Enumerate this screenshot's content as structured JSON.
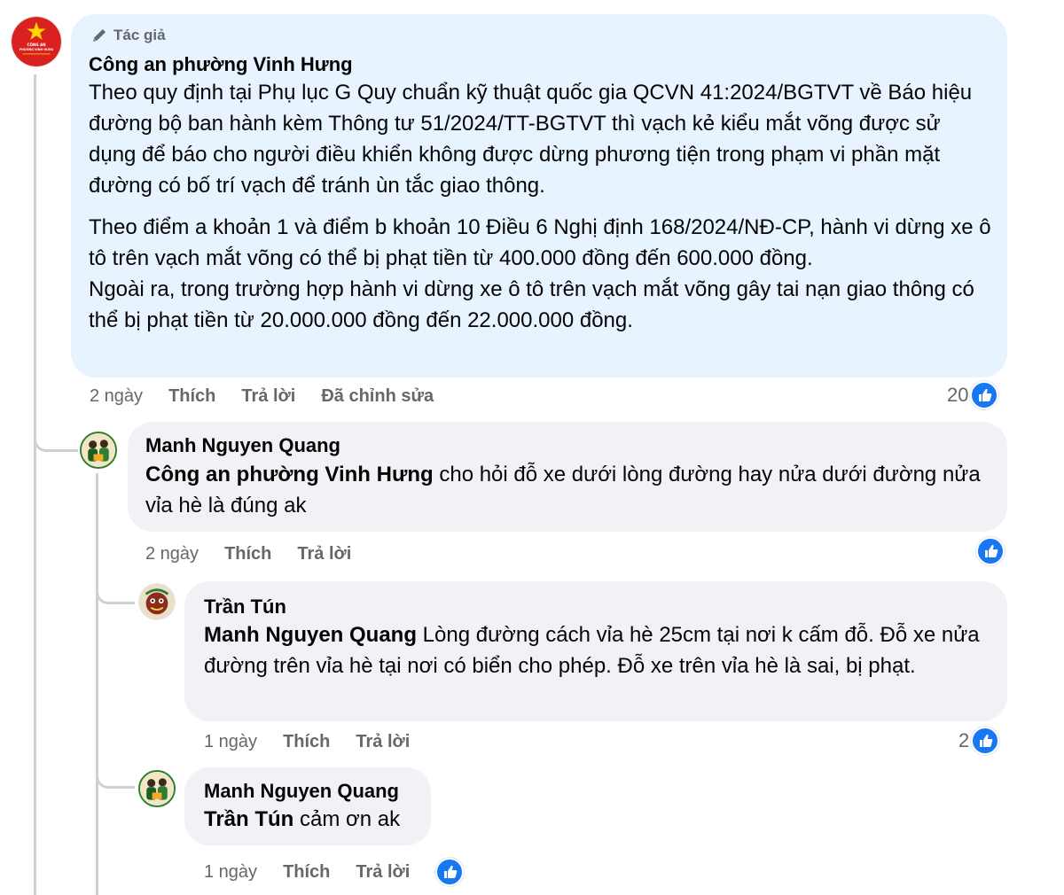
{
  "comments": [
    {
      "author_badge": "Tác giả",
      "author": "Công an phường Vinh Hưng",
      "paragraph1": "Theo quy định tại Phụ lục G Quy chuẩn kỹ thuật quốc gia QCVN 41:2024/BGTVT về Báo hiệu đường bộ ban hành kèm Thông tư 51/2024/TT-BGTVT thì vạch kẻ kiểu mắt võng được sử dụng để báo cho người điều khiển không được dừng phương tiện trong phạm vi phần mặt đường có bố trí vạch để tránh ùn tắc giao thông.",
      "paragraph2": "Theo điểm a khoản 1 và điểm b khoản 10 Điều 6 Nghị định 168/2024/NĐ-CP, hành vi dừng xe ô tô trên vạch mắt võng có thể bị phạt tiền từ 400.000 đồng đến 600.000 đồng.",
      "paragraph3": "Ngoài ra, trong trường hợp hành vi dừng xe ô tô trên vạch mắt võng gây tai nạn giao thông có thể bị phạt tiền từ 20.000.000 đồng đến 22.000.000 đồng.",
      "time": "2 ngày",
      "like_label": "Thích",
      "reply_label": "Trả lời",
      "edited_label": "Đã chỉnh sửa",
      "reaction_count": "20",
      "avatar_text": [
        "CÔNG AN",
        "PHƯỜNG VINH HƯNG"
      ]
    },
    {
      "author": "Manh Nguyen Quang",
      "mention": "Công an phường Vinh Hưng",
      "text": " cho hỏi đỗ xe dưới lòng đường hay nửa dưới đường nửa vỉa hè là đúng ak",
      "time": "2 ngày",
      "like_label": "Thích",
      "reply_label": "Trả lời",
      "reaction_count": ""
    },
    {
      "author": "Trần Tún",
      "mention": "Manh Nguyen Quang",
      "text": " Lòng đường cách vỉa hè 25cm tại nơi k cấm đỗ. Đỗ xe nửa đường trên vỉa hè tại nơi có biển cho phép. Đỗ xe trên vỉa hè là sai, bị phạt.",
      "time": "1 ngày",
      "like_label": "Thích",
      "reply_label": "Trả lời",
      "reaction_count": "2"
    },
    {
      "author": "Manh Nguyen Quang",
      "mention": "Trần Tún",
      "text": " cảm ơn ak",
      "time": "1 ngày",
      "like_label": "Thích",
      "reply_label": "Trả lời",
      "reaction_count": ""
    }
  ],
  "colors": {
    "main_bubble": "#e7f3ff",
    "reply_bubble": "#f0f2f5",
    "like_blue": "#1877f2",
    "thread_line": "#ced0d4",
    "meta_text": "#65676b"
  },
  "icons": {
    "badge": "pen-icon",
    "reaction": "like-icon"
  }
}
